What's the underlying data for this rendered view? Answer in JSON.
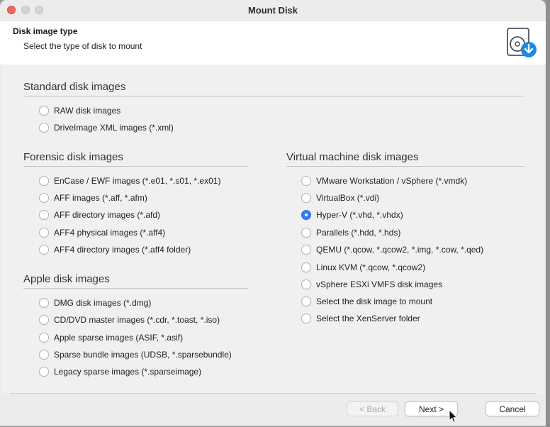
{
  "window": {
    "title": "Mount Disk"
  },
  "header": {
    "title": "Disk image type",
    "subtitle": "Select the type of disk to mount",
    "icon": "disk-download-icon"
  },
  "groups": {
    "standard": {
      "title": "Standard disk images",
      "options": [
        "RAW disk images",
        "DriveImage XML images (*.xml)"
      ]
    },
    "forensic": {
      "title": "Forensic disk images",
      "options": [
        "EnCase / EWF images (*.e01, *.s01, *.ex01)",
        "AFF images (*.aff, *.afm)",
        "AFF directory images (*.afd)",
        "AFF4 physical images (*.aff4)",
        "AFF4 directory images (*.aff4 folder)"
      ]
    },
    "apple": {
      "title": "Apple disk images",
      "options": [
        "DMG disk images (*.dmg)",
        "CD/DVD master images (*.cdr, *.toast, *.iso)",
        "Apple sparse images (ASIF, *.asif)",
        "Sparse bundle images (UDSB, *.sparsebundle)",
        "Legacy sparse images (*.sparseimage)"
      ]
    },
    "virtual": {
      "title": "Virtual machine disk images",
      "options": [
        "VMware Workstation / vSphere (*.vmdk)",
        "VirtualBox (*.vdi)",
        "Hyper-V (*.vhd, *.vhdx)",
        "Parallels (*.hdd, *.hds)",
        "QEMU (*.qcow, *.qcow2, *.img, *.cow, *.qed)",
        "Linux KVM (*.qcow, *.qcow2)",
        "vSphere ESXi VMFS disk images",
        "Select the disk image to mount",
        "Select the XenServer folder"
      ]
    }
  },
  "selected": "Hyper-V (*.vhd, *.vhdx)",
  "buttons": {
    "back": "< Back",
    "next": "Next >",
    "cancel": "Cancel"
  },
  "colors": {
    "accent": "#2f7cf6",
    "close": "#ed6a5e",
    "icon_badge": "#1e88e5"
  }
}
